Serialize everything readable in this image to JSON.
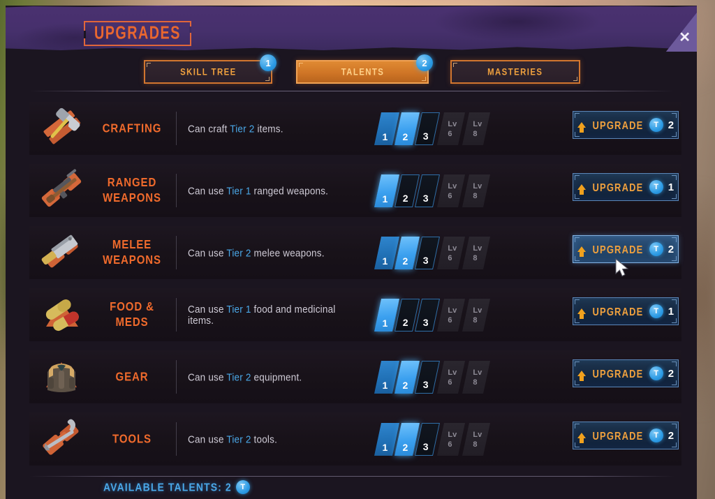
{
  "window": {
    "title": "UPGRADES",
    "close_icon": "close-icon",
    "accent_orange": "#ef6a2c",
    "accent_blue": "#4aa8e8",
    "header_purple": "#46306c"
  },
  "tabs": [
    {
      "label": "SKILL TREE",
      "badge": "1",
      "active": false
    },
    {
      "label": "TALENTS",
      "badge": "2",
      "active": true
    },
    {
      "label": "MASTERIES",
      "badge": "",
      "active": false
    }
  ],
  "rows": [
    {
      "icon": "hammer-and-planks-icon",
      "name": "CRAFTING",
      "desc_pre": "Can craft ",
      "desc_tier": "Tier 2",
      "desc_post": " items.",
      "slots": [
        {
          "label": "1",
          "state": "filled"
        },
        {
          "label": "2",
          "state": "current"
        },
        {
          "label": "3",
          "state": "empty"
        }
      ],
      "locked": [
        {
          "lv": "Lv",
          "num": "6"
        },
        {
          "lv": "Lv",
          "num": "8"
        }
      ],
      "upgrade_label": "UPGRADE",
      "token_label": "T",
      "cost": "2",
      "hover": false
    },
    {
      "icon": "rifle-icon",
      "name": "RANGED WEAPONS",
      "desc_pre": "Can use ",
      "desc_tier": "Tier 1",
      "desc_post": " ranged weapons.",
      "slots": [
        {
          "label": "1",
          "state": "current"
        },
        {
          "label": "2",
          "state": "empty"
        },
        {
          "label": "3",
          "state": "empty"
        }
      ],
      "locked": [
        {
          "lv": "Lv",
          "num": "6"
        },
        {
          "lv": "Lv",
          "num": "8"
        }
      ],
      "upgrade_label": "UPGRADE",
      "token_label": "T",
      "cost": "1",
      "hover": false
    },
    {
      "icon": "cleaver-icon",
      "name": "MELEE WEAPONS",
      "desc_pre": "Can use ",
      "desc_tier": "Tier 2",
      "desc_post": " melee weapons.",
      "slots": [
        {
          "label": "1",
          "state": "filled"
        },
        {
          "label": "2",
          "state": "current"
        },
        {
          "label": "3",
          "state": "empty"
        }
      ],
      "locked": [
        {
          "lv": "Lv",
          "num": "6"
        },
        {
          "lv": "Lv",
          "num": "8"
        }
      ],
      "upgrade_label": "UPGRADE",
      "token_label": "T",
      "cost": "2",
      "hover": true
    },
    {
      "icon": "pills-icon",
      "name": "FOOD & MEDS",
      "desc_pre": "Can use ",
      "desc_tier": "Tier 1",
      "desc_post": " food and medicinal items.",
      "slots": [
        {
          "label": "1",
          "state": "current"
        },
        {
          "label": "2",
          "state": "empty"
        },
        {
          "label": "3",
          "state": "empty"
        }
      ],
      "locked": [
        {
          "lv": "Lv",
          "num": "6"
        },
        {
          "lv": "Lv",
          "num": "8"
        }
      ],
      "upgrade_label": "UPGRADE",
      "token_label": "T",
      "cost": "1",
      "hover": false
    },
    {
      "icon": "jacket-icon",
      "name": "GEAR",
      "desc_pre": "Can use ",
      "desc_tier": "Tier 2",
      "desc_post": " equipment.",
      "slots": [
        {
          "label": "1",
          "state": "filled"
        },
        {
          "label": "2",
          "state": "current"
        },
        {
          "label": "3",
          "state": "empty"
        }
      ],
      "locked": [
        {
          "lv": "Lv",
          "num": "6"
        },
        {
          "lv": "Lv",
          "num": "8"
        }
      ],
      "upgrade_label": "UPGRADE",
      "token_label": "T",
      "cost": "2",
      "hover": false
    },
    {
      "icon": "crowbar-icon",
      "name": "TOOLS",
      "desc_pre": "Can use ",
      "desc_tier": "Tier 2",
      "desc_post": " tools.",
      "slots": [
        {
          "label": "1",
          "state": "filled"
        },
        {
          "label": "2",
          "state": "current"
        },
        {
          "label": "3",
          "state": "empty"
        }
      ],
      "locked": [
        {
          "lv": "Lv",
          "num": "6"
        },
        {
          "lv": "Lv",
          "num": "8"
        }
      ],
      "upgrade_label": "UPGRADE",
      "token_label": "T",
      "cost": "2",
      "hover": false
    }
  ],
  "footer": {
    "available_label": "AVAILABLE TALENTS: 2",
    "token_label": "T"
  }
}
